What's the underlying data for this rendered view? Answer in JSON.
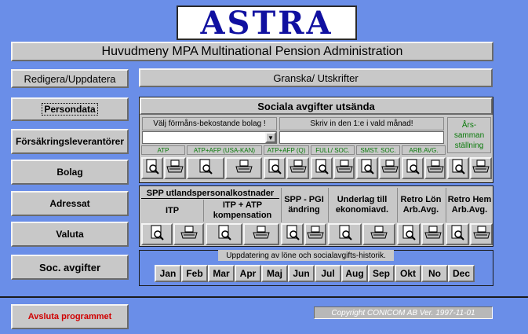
{
  "logo_text": "ASTRA",
  "title": "Huvudmeny  MPA   Multinational Pension Administration",
  "left_header": "Redigera/Uppdatera",
  "left_buttons": [
    "Persondata",
    "Försäkringsleverantörer",
    "Bolag",
    "Adressat",
    "Valuta",
    "Soc. avgifter"
  ],
  "exit_label": "Avsluta programmet",
  "copyright": "Copyright  CONICOM AB  Ver. 1997-11-01",
  "right_header": "Granska/ Utskrifter",
  "soc": {
    "title": "Sociala avgifter utsända",
    "select_label": "Välj förmåns-bekostande bolag !",
    "month_label": "Skriv in den 1:e   i vald månad!",
    "summary_label": "Års- samman ställning",
    "columns": [
      "ATP",
      "ATP+AFP (USA-KAN)",
      "ATP+AFP (Q)",
      "FULL/ SOC.",
      "SMST. SOC.",
      "ARB.AVG."
    ]
  },
  "spp": {
    "title": "SPP  utlandspersonalkostnader",
    "itp": "ITP",
    "itp_atp": "ITP + ATP kompensation",
    "pgi": "SPP - PGI ändring",
    "underlag": "Underlag till ekonomiavd.",
    "retro_lon": "Retro Lön Arb.Avg.",
    "retro_hem": "Retro Hem Arb.Avg."
  },
  "history": {
    "label": "Uppdatering av löne och socialavgifts-historik.",
    "months": [
      "Jan",
      "Feb",
      "Mar",
      "Apr",
      "Maj",
      "Jun",
      "Jul",
      "Aug",
      "Sep",
      "Okt",
      "No",
      "Dec"
    ]
  },
  "colors": {
    "background": "#6a8ee8",
    "panel": "#c8c8c8",
    "logo_bg": "#ffffff",
    "logo_text": "#1010a0",
    "exit_text": "#d00000",
    "green_text": "#0a7a0a"
  },
  "icons": {
    "preview": "magnifier-page-icon",
    "print": "printer-icon",
    "dropdown": "chevron-down-icon"
  }
}
